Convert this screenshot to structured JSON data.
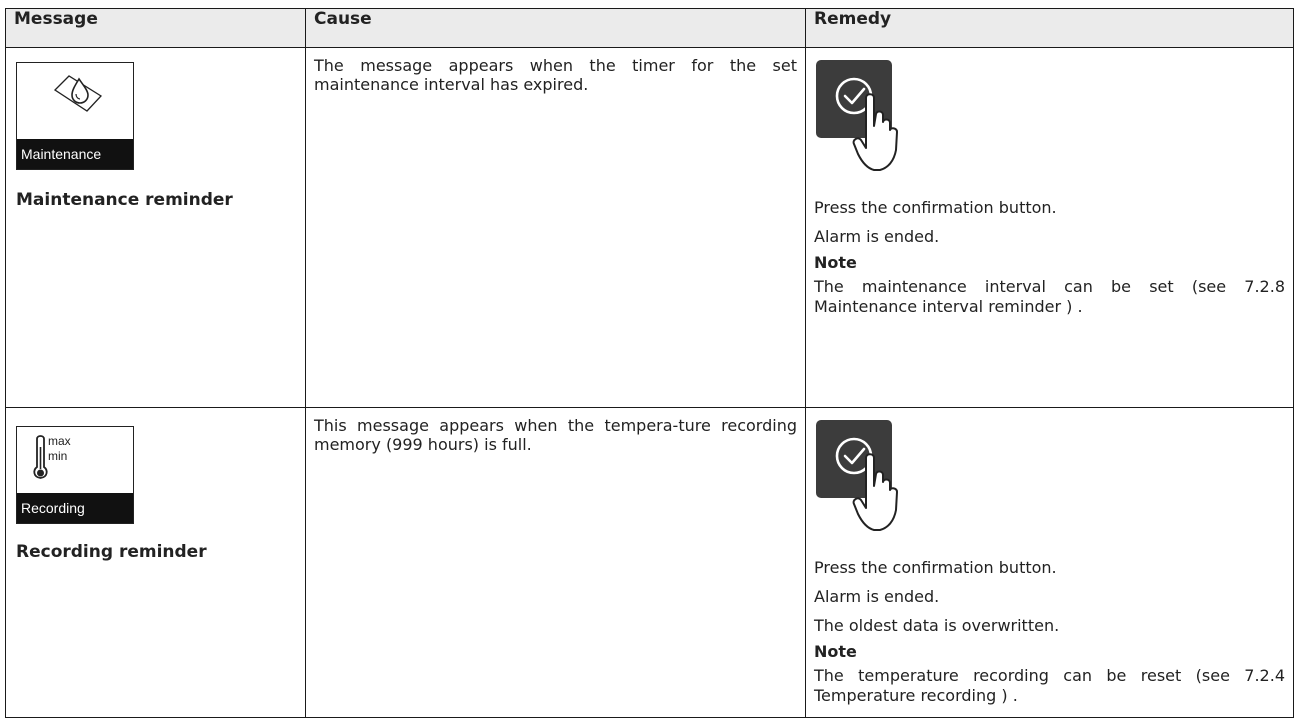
{
  "table": {
    "headers": {
      "message": "Message",
      "cause": "Cause",
      "remedy": "Remedy"
    },
    "rows": [
      {
        "display_label": "Maintenance",
        "display_icon": "maintenance-drop-icon",
        "message_name": "Maintenance reminder",
        "cause": "The message appears when the timer for the set maintenance interval has expired.",
        "remedy_lines": [
          "Press the confirmation button.",
          "Alarm is ended."
        ],
        "note_heading": "Note",
        "note_text": "The maintenance interval can be set (see 7.2.8 Maintenance interval reminder ) ."
      },
      {
        "display_label": "Recording",
        "display_icon": "thermometer-icon",
        "icon_text_max": "max",
        "icon_text_min": "min",
        "message_name": "Recording reminder",
        "cause": "This message appears when the tempera-ture recording memory (999 hours) is full.",
        "remedy_lines": [
          "Press the confirmation button.",
          "Alarm is ended.",
          "The oldest data is overwritten."
        ],
        "note_heading": "Note",
        "note_text": "The temperature recording can be reset (see 7.2.4 Temperature recording ) ."
      }
    ]
  },
  "colors": {
    "header_bg": "#ebebeb",
    "button_bg": "#3c3c3c",
    "label_bg": "#111111"
  }
}
